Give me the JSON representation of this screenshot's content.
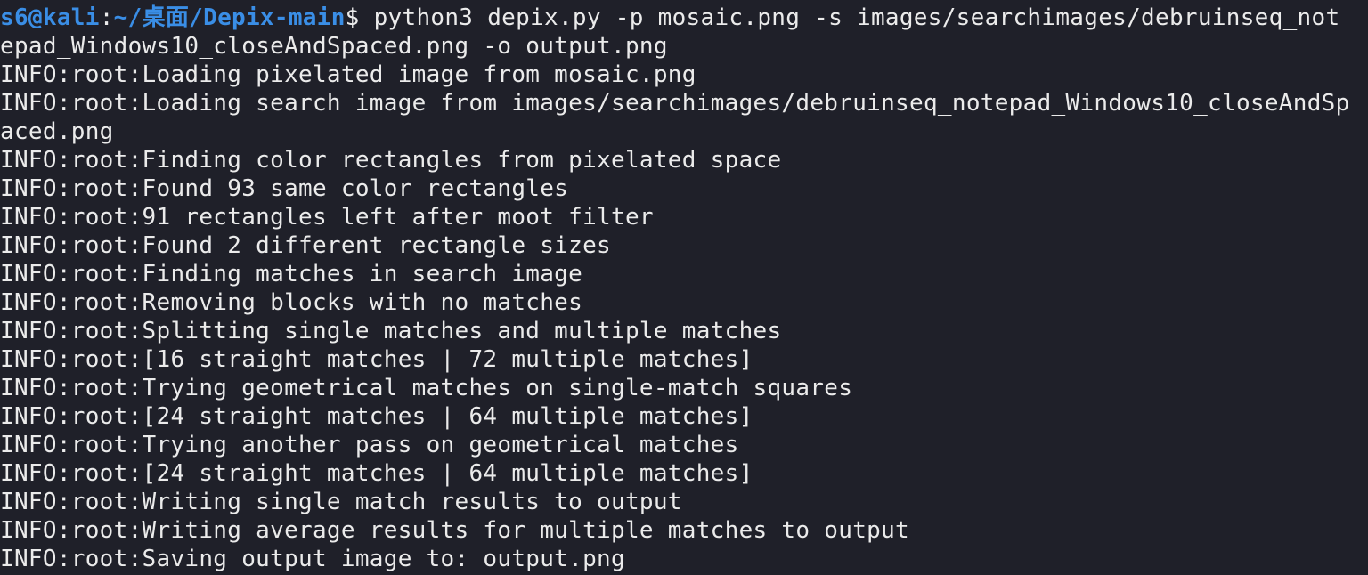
{
  "terminal": {
    "prompt": {
      "user_host": "s6@kali",
      "separator": ":",
      "path": "~/桌面/Depix-main",
      "symbol": "$ "
    },
    "command_line_1": "python3 depix.py -p mosaic.png -s images/searchimages/debruinseq_not",
    "command_line_2": "epad_Windows10_closeAndSpaced.png -o output.png",
    "output_lines": [
      "INFO:root:Loading pixelated image from mosaic.png",
      "INFO:root:Loading search image from images/searchimages/debruinseq_notepad_Windows10_closeAndSp",
      "aced.png",
      "INFO:root:Finding color rectangles from pixelated space",
      "INFO:root:Found 93 same color rectangles",
      "INFO:root:91 rectangles left after moot filter",
      "INFO:root:Found 2 different rectangle sizes",
      "INFO:root:Finding matches in search image",
      "INFO:root:Removing blocks with no matches",
      "INFO:root:Splitting single matches and multiple matches",
      "INFO:root:[16 straight matches | 72 multiple matches]",
      "INFO:root:Trying geometrical matches on single-match squares",
      "INFO:root:[24 straight matches | 64 multiple matches]",
      "INFO:root:Trying another pass on geometrical matches",
      "INFO:root:[24 straight matches | 64 multiple matches]",
      "INFO:root:Writing single match results to output",
      "INFO:root:Writing average results for multiple matches to output",
      "INFO:root:Saving output image to: output.png"
    ],
    "colors": {
      "background": "#1f2029",
      "text": "#ebebeb",
      "prompt": "#3a8ee6"
    }
  }
}
